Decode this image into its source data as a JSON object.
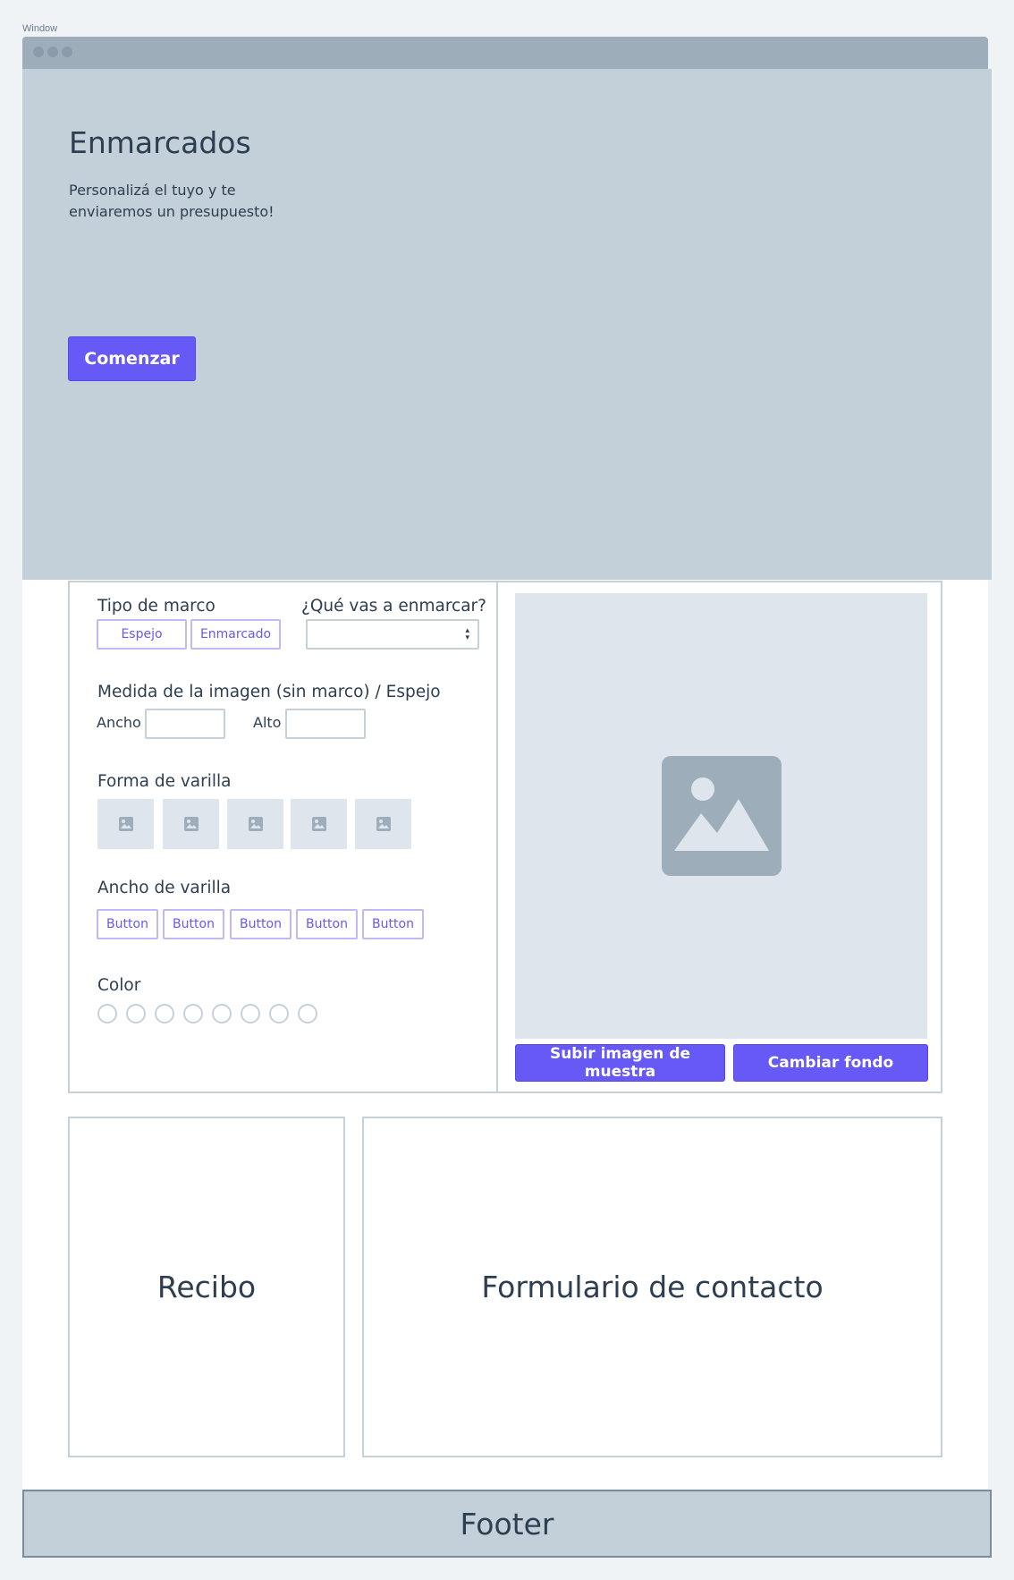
{
  "window": {
    "label": "Window"
  },
  "hero": {
    "title": "Enmarcados",
    "subtitle": "Personalizá el tuyo y te enviaremos un presupuesto!",
    "cta_label": "Comenzar"
  },
  "config": {
    "frame_type": {
      "label": "Tipo de marco",
      "options": [
        "Espejo",
        "Enmarcado"
      ]
    },
    "what_to_frame": {
      "label": "¿Qué vas a enmarcar?",
      "selected": ""
    },
    "size": {
      "label": "Medida de la imagen (sin marco) / Espejo",
      "width_label": "Ancho",
      "height_label": "Alto",
      "width_value": "",
      "height_value": ""
    },
    "rod_shape": {
      "label": "Forma de varilla",
      "options": [
        "image-icon",
        "image-icon",
        "image-icon",
        "image-icon",
        "image-icon"
      ]
    },
    "rod_width": {
      "label": "Ancho de varilla",
      "options": [
        "Button",
        "Button",
        "Button",
        "Button",
        "Button"
      ]
    },
    "color": {
      "label": "Color",
      "swatch_count": 8
    }
  },
  "preview": {
    "icon": "image-placeholder-icon",
    "upload_label": "Subir imagen de muestra",
    "background_label": "Cambiar fondo"
  },
  "receipt": {
    "title": "Recibo"
  },
  "contact": {
    "title": "Formulario de contacto"
  },
  "footer": {
    "label": "Footer"
  },
  "colors": {
    "accent": "#6659f5",
    "hero_bg": "#c3d0d9",
    "border": "#c5d0d9",
    "placeholder_bg": "#dfe5ed"
  }
}
